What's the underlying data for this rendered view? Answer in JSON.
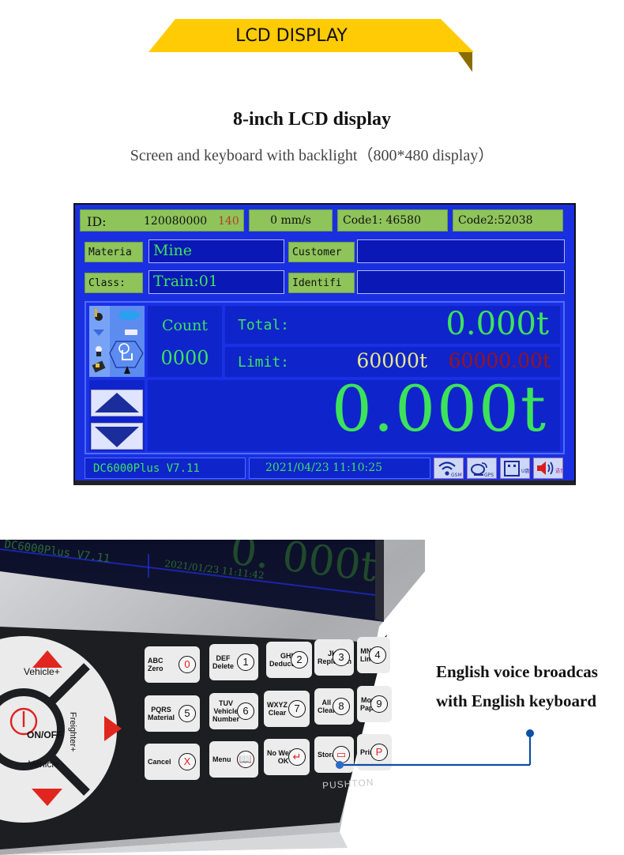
{
  "banner": {
    "title": "LCD DISPLAY",
    "color": "#ffcb05",
    "fold_color": "#8a6d00"
  },
  "headline": "8-inch LCD display",
  "subheadline": "Screen and keyboard with backlight（800*480 display）",
  "lcd": {
    "top_row": {
      "id_label": "ID:",
      "id_value": "120080000",
      "id_suffix": "140",
      "speed": "0 mm/s",
      "code1": "Code1: 46580",
      "code2": "Code2:52038"
    },
    "fields": [
      {
        "label": "Materia",
        "value": "Mine"
      },
      {
        "label": "Customer",
        "value": ""
      },
      {
        "label": "Class:",
        "value": "Train:01"
      },
      {
        "label": "Identifi",
        "value": ""
      }
    ],
    "count_label": "Count",
    "count_value": "0000",
    "total_label": "Total:",
    "total_value": "0.000t",
    "limit_label": "Limit:",
    "limit_value": "60000t",
    "limit_value_alt": "60000.00t",
    "main_weight": "0.000t",
    "model": "DC6000Plus V7.11",
    "datetime": "2021/04/23 11:10:25",
    "status_icons": [
      {
        "name": "gsm",
        "label": "GSM"
      },
      {
        "name": "gps",
        "label": "GPS"
      },
      {
        "name": "usb",
        "label": "U盘"
      },
      {
        "name": "voice",
        "label": "语音"
      }
    ],
    "colors": {
      "background": "#1a2fe0",
      "text": "#3ce35a",
      "label_bg": "#8ec45a"
    }
  },
  "device": {
    "screen_model": "DC6000Plus V7.11",
    "screen_time": "2021/01/23 11:11:42",
    "brand": "PUSHTON",
    "dpad": {
      "up": "Vehicle+",
      "down": "Vehicle -",
      "right": "Freighter+",
      "center": "ON/OFF"
    },
    "keys": [
      {
        "label": "ABC\nZero",
        "glyph": "0",
        "red": true
      },
      {
        "label": "DEF\nDelete",
        "glyph": "1",
        "red": false
      },
      {
        "label": "GHI\nDeduction",
        "glyph": "2",
        "red": false
      },
      {
        "label": "JKL\nReplenish",
        "glyph": "3",
        "red": false
      },
      {
        "label": "MNO\nLimit",
        "glyph": "4",
        "red": false
      },
      {
        "label": "PQRS\nMaterial",
        "glyph": "5",
        "red": false
      },
      {
        "label": "TUV\nVehicle\nNumber",
        "glyph": "6",
        "red": false
      },
      {
        "label": "WXYZ\nClear",
        "glyph": "7",
        "red": false
      },
      {
        "label": "All\nClear",
        "glyph": "8",
        "red": false
      },
      {
        "label": "Move\nPaper",
        "glyph": "9",
        "red": false
      },
      {
        "label": "Cancel",
        "glyph": "X",
        "red": true
      },
      {
        "label": "Menu",
        "glyph": "📖",
        "red": true
      },
      {
        "label": "No Weigh\nOK",
        "glyph": "↵",
        "red": true
      },
      {
        "label": "Storage",
        "glyph": "▭",
        "red": true
      },
      {
        "label": "Print",
        "glyph": "P",
        "red": true
      }
    ]
  },
  "callout": {
    "line1": "English voice broadcas",
    "line2": "with English keyboard",
    "color": "#0d4ea6"
  }
}
